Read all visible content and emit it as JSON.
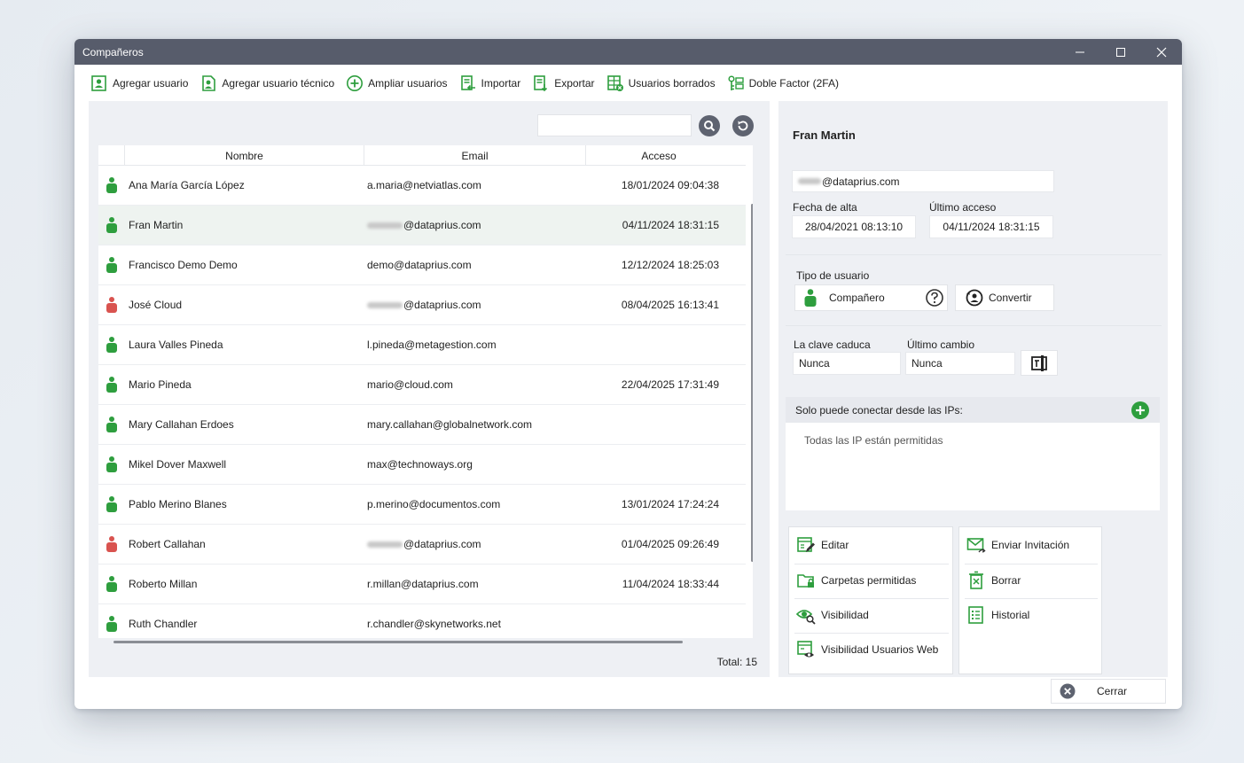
{
  "window": {
    "title": "Compañeros"
  },
  "toolbar": [
    {
      "label": "Agregar usuario",
      "icon": "add-user-icon"
    },
    {
      "label": "Agregar usuario técnico",
      "icon": "add-tech-user-icon"
    },
    {
      "label": "Ampliar usuarios",
      "icon": "plus-circle-icon"
    },
    {
      "label": "Importar",
      "icon": "import-icon"
    },
    {
      "label": "Exportar",
      "icon": "export-icon"
    },
    {
      "label": "Usuarios borrados",
      "icon": "deleted-users-icon"
    },
    {
      "label": "Doble Factor (2FA)",
      "icon": "two-factor-icon"
    }
  ],
  "search": {
    "value": "",
    "placeholder": ""
  },
  "grid": {
    "columns": [
      "Nombre",
      "Email",
      "Acceso"
    ],
    "rows": [
      {
        "name": "Ana María García López",
        "email_prefix": "",
        "email": "a.maria@netviatlas.com",
        "access": "18/01/2024 09:04:38",
        "status": "green"
      },
      {
        "name": "Fran Martin",
        "email_prefix": "blur",
        "email": "@dataprius.com",
        "access": "04/11/2024 18:31:15",
        "status": "green",
        "selected": true
      },
      {
        "name": "Francisco Demo Demo",
        "email_prefix": "",
        "email": "demo@dataprius.com",
        "access": "12/12/2024 18:25:03",
        "status": "green"
      },
      {
        "name": "José Cloud",
        "email_prefix": "blur",
        "email": "@dataprius.com",
        "access": "08/04/2025 16:13:41",
        "status": "red"
      },
      {
        "name": "Laura Valles Pineda",
        "email_prefix": "",
        "email": "l.pineda@metagestion.com",
        "access": "",
        "status": "green"
      },
      {
        "name": "Mario Pineda",
        "email_prefix": "",
        "email": "mario@cloud.com",
        "access": "22/04/2025 17:31:49",
        "status": "green"
      },
      {
        "name": "Mary Callahan Erdoes",
        "email_prefix": "",
        "email": "mary.callahan@globalnetwork.com",
        "access": "",
        "status": "green"
      },
      {
        "name": "Mikel Dover Maxwell",
        "email_prefix": "",
        "email": "max@technoways.org",
        "access": "",
        "status": "green"
      },
      {
        "name": "Pablo Merino Blanes",
        "email_prefix": "",
        "email": "p.merino@documentos.com",
        "access": "13/01/2024 17:24:24",
        "status": "green"
      },
      {
        "name": "Robert Callahan",
        "email_prefix": "blur",
        "email": "@dataprius.com",
        "access": "01/04/2025 09:26:49",
        "status": "red"
      },
      {
        "name": "Roberto Millan",
        "email_prefix": "",
        "email": "r.millan@dataprius.com",
        "access": "11/04/2024 18:33:44",
        "status": "green"
      },
      {
        "name": "Ruth Chandler",
        "email_prefix": "",
        "email": "r.chandler@skynetworks.net",
        "access": "",
        "status": "green"
      }
    ],
    "total": "Total: 15"
  },
  "detail": {
    "name": "Fran Martin",
    "email": "@dataprius.com",
    "fecha_alta_label": "Fecha de alta",
    "fecha_alta": "28/04/2021 08:13:10",
    "ultimo_acceso_label": "Último acceso",
    "ultimo_acceso": "04/11/2024 18:31:15",
    "tipo_label": "Tipo de usuario",
    "tipo": "Compañero",
    "convertir": "Convertir",
    "clave_caduca_label": "La clave caduca",
    "clave_caduca": "Nunca",
    "ultimo_cambio_label": "Último cambio",
    "ultimo_cambio": "Nunca",
    "ips_label": "Solo puede conectar desde las IPs:",
    "ips_empty": "Todas las IP están permitidas"
  },
  "actions_left": [
    "Editar",
    "Carpetas permitidas",
    "Visibilidad",
    "Visibilidad Usuarios Web"
  ],
  "actions_right": [
    "Enviar Invitación",
    "Borrar",
    "Historial"
  ],
  "close_label": "Cerrar",
  "colors": {
    "accent_green": "#2e9e3e",
    "status_red": "#d9534f",
    "titlebar": "#575c6b"
  }
}
